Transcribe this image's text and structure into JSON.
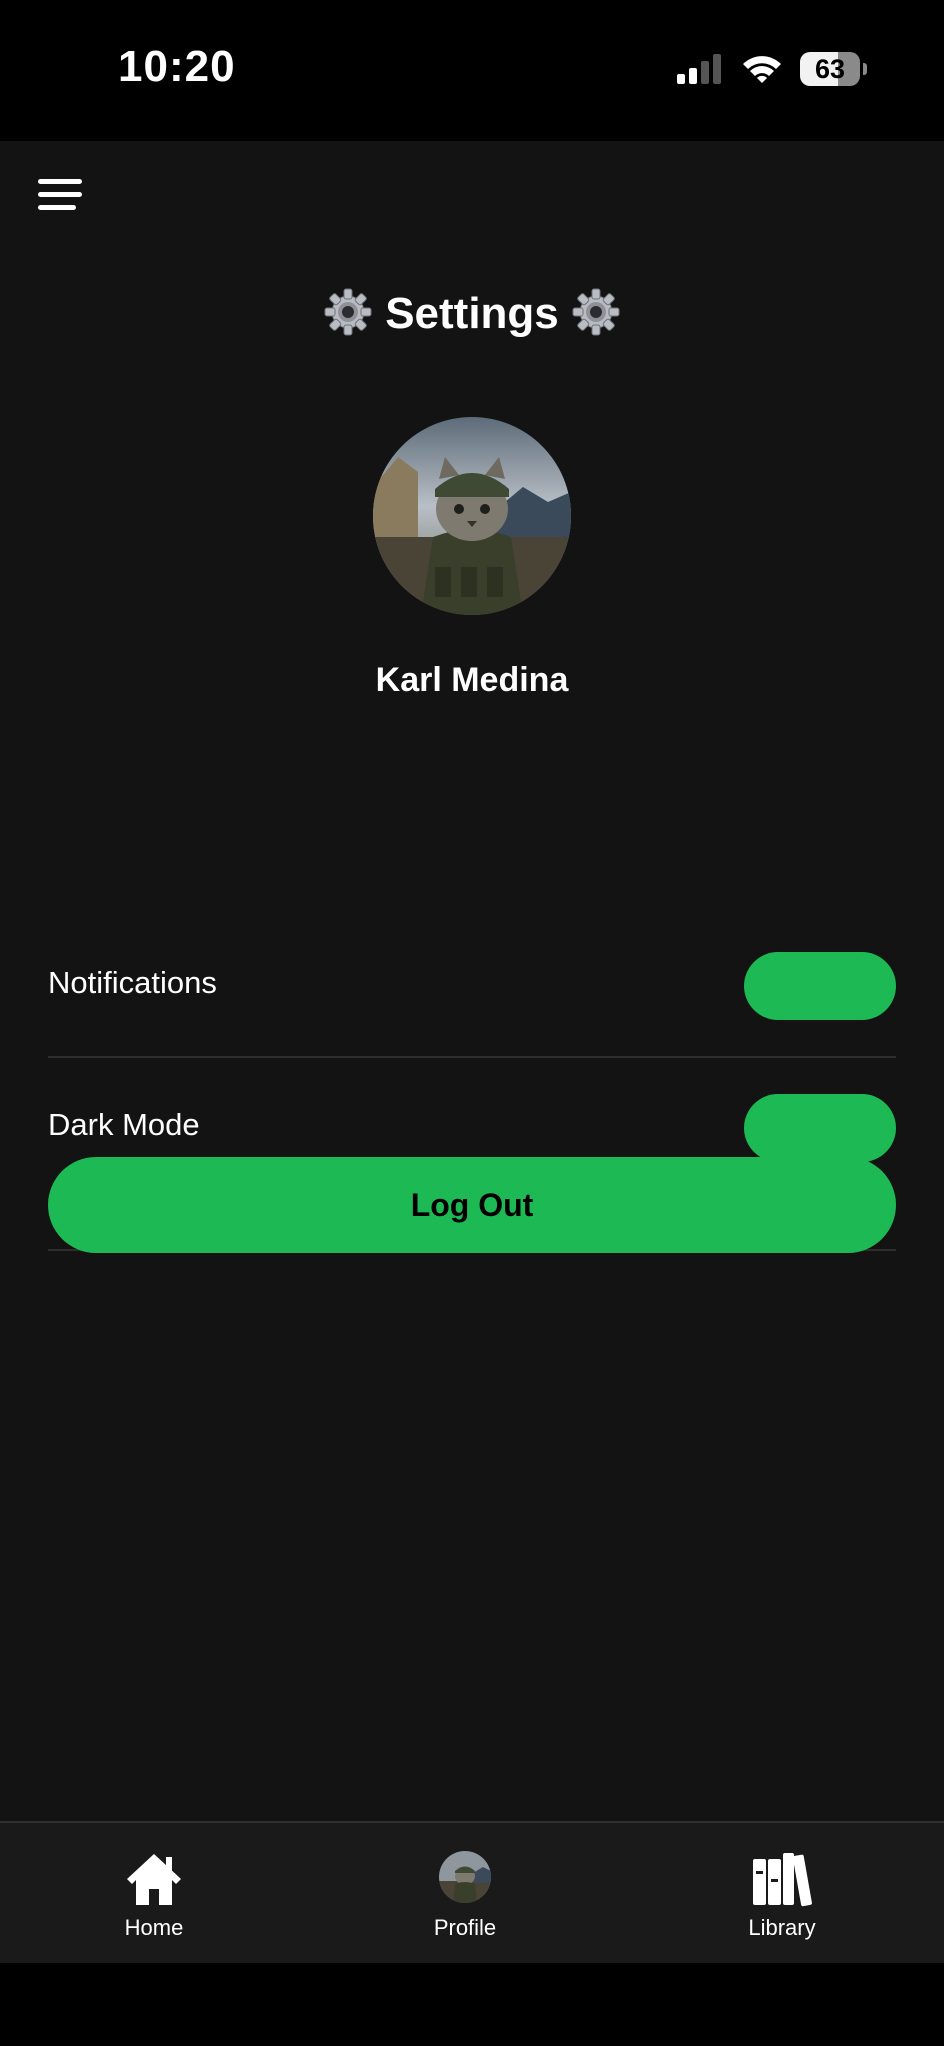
{
  "status_bar": {
    "time": "10:20",
    "battery_level": "63",
    "signal_icon": "cellular-signal-icon",
    "wifi_icon": "wifi-icon"
  },
  "header": {
    "menu_icon": "hamburger-menu-icon",
    "title": "Settings",
    "title_icon": "gear-icon"
  },
  "profile": {
    "name": "Karl Medina",
    "avatar": "cat-soldier-avatar"
  },
  "settings": [
    {
      "label": "Notifications",
      "enabled": true
    },
    {
      "label": "Dark Mode",
      "enabled": true
    }
  ],
  "logout": {
    "label": "Log Out"
  },
  "tab_bar": {
    "items": [
      {
        "label": "Home",
        "icon": "house-icon"
      },
      {
        "label": "Profile",
        "icon": "avatar-icon"
      },
      {
        "label": "Library",
        "icon": "books-icon"
      }
    ]
  },
  "colors": {
    "accent": "#1db954",
    "background": "#131313",
    "tab_bar": "#1a1a1a",
    "divider": "#2e2e2e",
    "text": "#ffffff"
  }
}
